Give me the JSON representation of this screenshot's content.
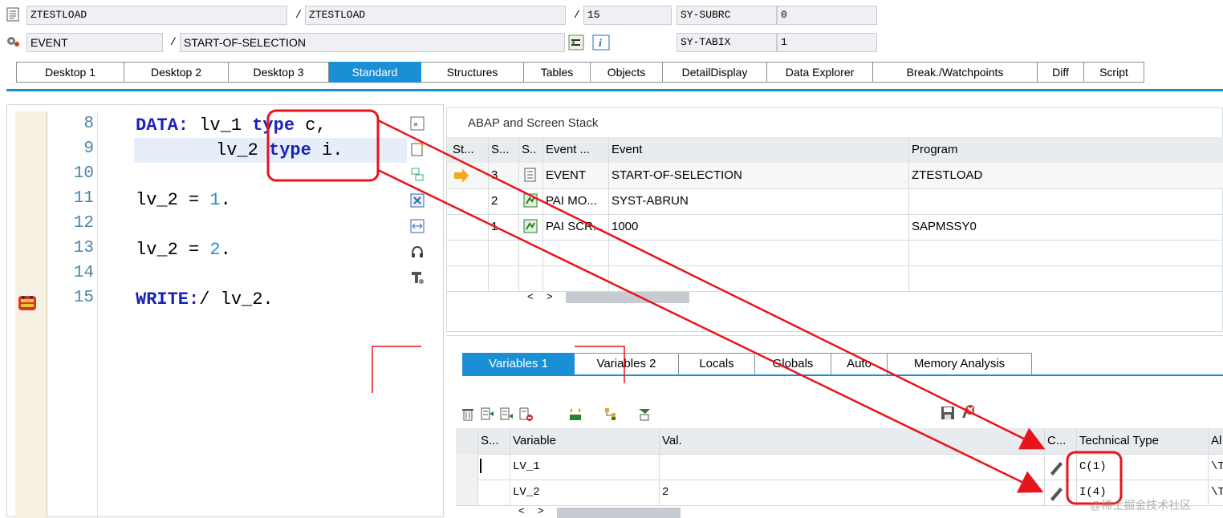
{
  "header": {
    "row1": {
      "program": "ZTESTLOAD",
      "include": "ZTESTLOAD",
      "line": "15",
      "sysfield": "SY-SUBRC",
      "sysvalue": "0"
    },
    "row2": {
      "event_type": "EVENT",
      "event": "START-OF-SELECTION",
      "sysfield": "SY-TABIX",
      "sysvalue": "1"
    },
    "slash": "/"
  },
  "tabs": [
    "Desktop 1",
    "Desktop 2",
    "Desktop 3",
    "Standard",
    "Structures",
    "Tables",
    "Objects",
    "DetailDisplay",
    "Data Explorer",
    "Break./Watchpoints",
    "Diff",
    "Script"
  ],
  "code": {
    "lines": [
      {
        "num": "8"
      },
      {
        "num": "9"
      },
      {
        "num": "10"
      },
      {
        "num": "11"
      },
      {
        "num": "12"
      },
      {
        "num": "13"
      },
      {
        "num": "14"
      },
      {
        "num": "15"
      }
    ],
    "l8_kw": "DATA:",
    "l8_var": " lv_1 ",
    "l8_type": "type",
    "l8_rest": " c,",
    "l9_var": "lv_2 ",
    "l9_type": "type",
    "l9_rest": " i.",
    "l11_var": "lv_2 = ",
    "l11_num": "1",
    "l11_end": ".",
    "l13_var": "lv_2 = ",
    "l13_num": "2",
    "l13_end": ".",
    "l15_kw": "WRITE:",
    "l15_rest": "/ lv_2."
  },
  "stack": {
    "title": "ABAP and Screen Stack",
    "headers": [
      "St...",
      "S...",
      "S..",
      "Event ...",
      "Event",
      "Program"
    ],
    "rows": [
      {
        "level": "3",
        "etype": "EVENT",
        "event": "START-OF-SELECTION",
        "program": "ZTESTLOAD"
      },
      {
        "level": "2",
        "etype": "PAI MO...",
        "event": "SYST-ABRUN",
        "program": ""
      },
      {
        "level": "1",
        "etype": "PAI SCR...",
        "event": "1000",
        "program": "SAPMSSY0"
      }
    ],
    "scroll": {
      "left": "<",
      "right": ">"
    }
  },
  "var_tabs": [
    "Variables 1",
    "Variables 2",
    "Locals",
    "Globals",
    "Auto",
    "Memory Analysis"
  ],
  "vars": {
    "headers": [
      "S...",
      "Variable",
      "Val.",
      "C...",
      "Technical Type",
      "Al"
    ],
    "rows": [
      {
        "name": "LV_1",
        "value": "",
        "type": "C(1)",
        "al": "\\T"
      },
      {
        "name": "LV_2",
        "value": "2",
        "type": "I(4)",
        "al": "\\T"
      }
    ]
  },
  "watermark": "@稀土掘金技术社区",
  "colors": {
    "accent": "#1b8fd6",
    "highlight": "#e8141c"
  }
}
